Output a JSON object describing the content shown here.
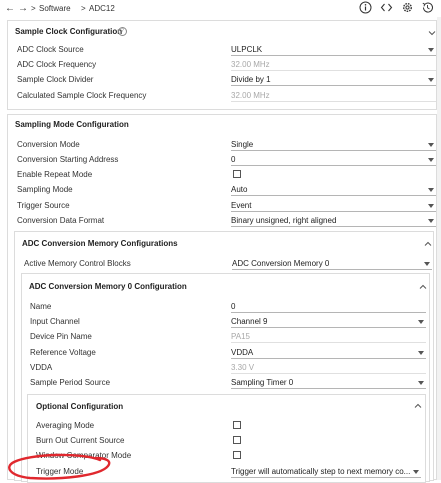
{
  "breadcrumb": {
    "software": "Software",
    "separator": ">",
    "module": "ADC12"
  },
  "toolbar_icons": [
    "info-icon",
    "code-icon",
    "settings-icon",
    "history-icon"
  ],
  "sample_clock": {
    "title": "Sample Clock Configuration",
    "rows": [
      {
        "label": "ADC Clock Source",
        "value": "ULPCLK"
      },
      {
        "label": "ADC Clock Frequency",
        "value": "32.00 MHz"
      },
      {
        "label": "Sample Clock Divider",
        "value": "Divide by 1"
      },
      {
        "label": "Calculated Sample Clock Frequency",
        "value": "32.00 MHz"
      }
    ]
  },
  "sampling_mode": {
    "title": "Sampling Mode Configuration",
    "rows": [
      {
        "label": "Conversion Mode",
        "value": "Single"
      },
      {
        "label": "Conversion Starting Address",
        "value": "0"
      },
      {
        "label": "Enable Repeat Mode",
        "value": ""
      },
      {
        "label": "Sampling Mode",
        "value": "Auto"
      },
      {
        "label": "Trigger Source",
        "value": "Event"
      },
      {
        "label": "Conversion Data Format",
        "value": "Binary unsigned, right aligned"
      }
    ]
  },
  "memory_configs": {
    "title": "ADC Conversion Memory Configurations",
    "active_label": "Active Memory Control Blocks",
    "active_value": "ADC Conversion Memory 0"
  },
  "memory0": {
    "title": "ADC Conversion Memory 0 Configuration",
    "rows": [
      {
        "label": "Name",
        "value": "0"
      },
      {
        "label": "Input Channel",
        "value": "Channel 9"
      },
      {
        "label": "Device Pin Name",
        "value": "PA15"
      },
      {
        "label": "Reference Voltage",
        "value": "VDDA"
      },
      {
        "label": "VDDA",
        "value": "3.30 V"
      },
      {
        "label": "Sample Period Source",
        "value": "Sampling Timer 0"
      }
    ]
  },
  "optional": {
    "title": "Optional Configuration",
    "rows": [
      {
        "label": "Averaging Mode"
      },
      {
        "label": "Burn Out Current Source"
      },
      {
        "label": "Window Comparator Mode"
      },
      {
        "label": "Trigger Mode",
        "value": "Trigger will automatically step to next memory co..."
      }
    ]
  },
  "annotation_color": "#e0282e"
}
